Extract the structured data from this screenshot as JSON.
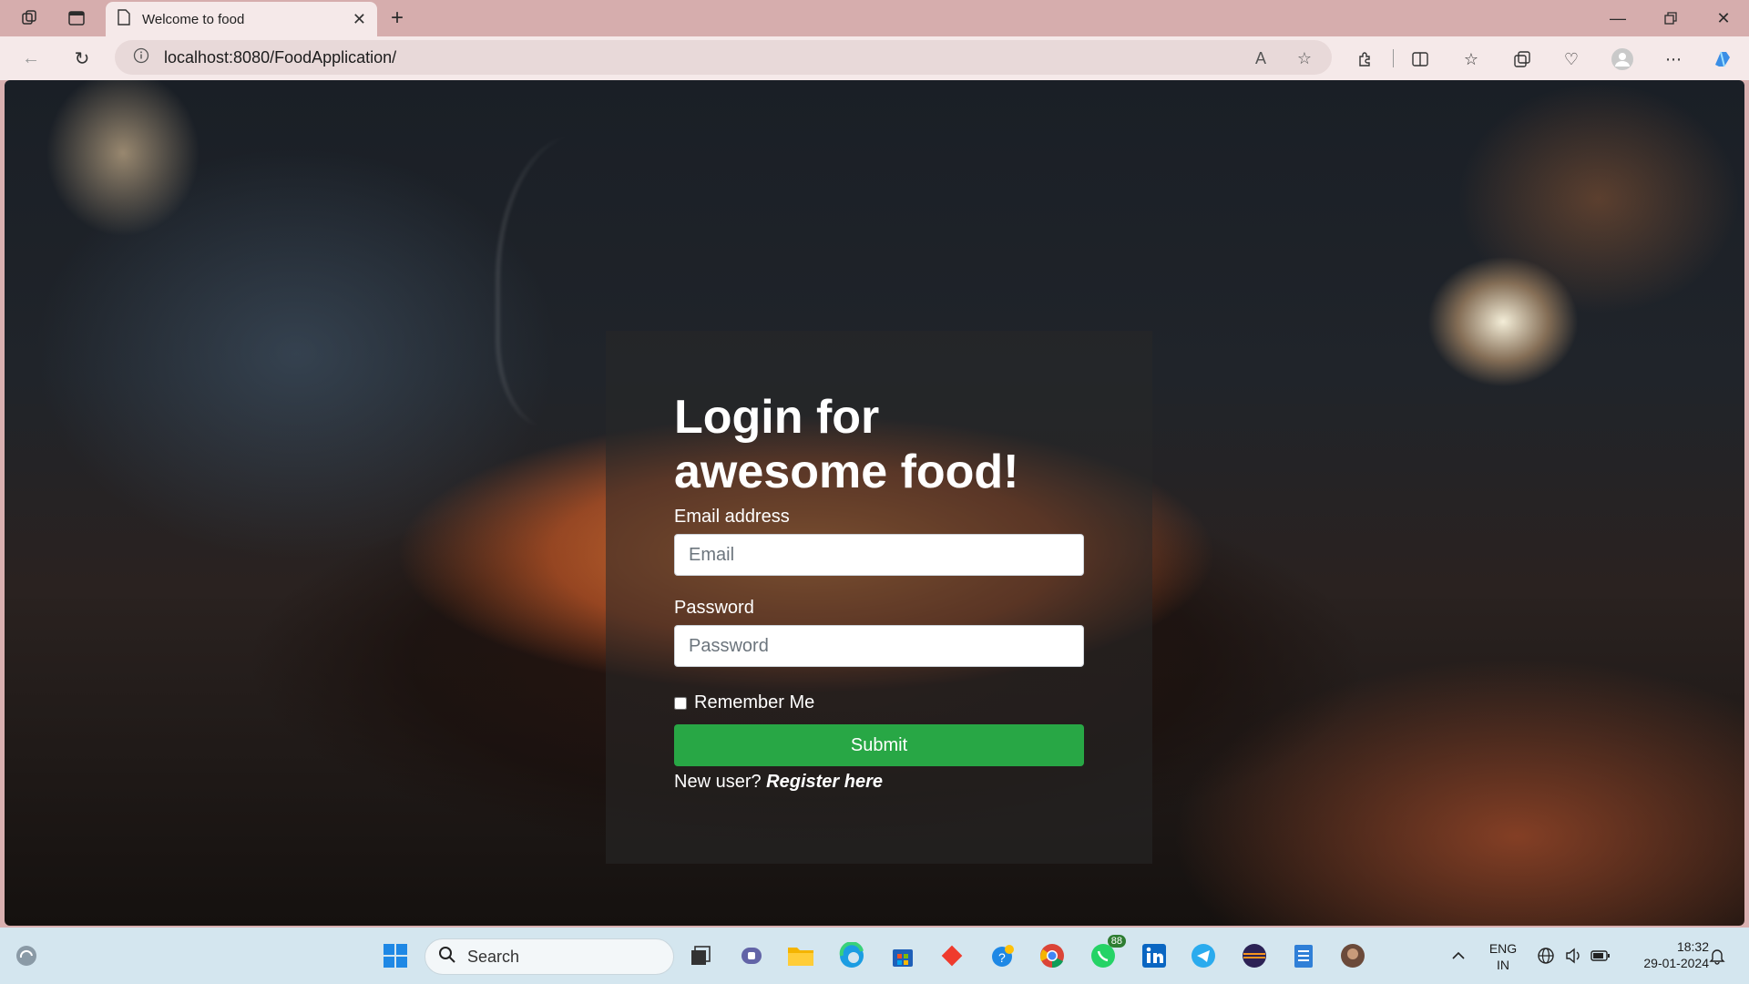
{
  "browser": {
    "tab_title": "Welcome to food",
    "url": "localhost:8080/FoodApplication/"
  },
  "login": {
    "title": "Login for awesome food!",
    "email_label": "Email address",
    "email_placeholder": "Email",
    "password_label": "Password",
    "password_placeholder": "Password",
    "remember_label": "Remember Me",
    "submit_label": "Submit",
    "new_user_text": "New user?",
    "register_link": "Register here"
  },
  "colors": {
    "submit_green": "#28a745",
    "taskbar_bg": "#d4e6ef",
    "tabbar_bg": "#d6adad"
  },
  "taskbar": {
    "search_label": "Search",
    "whatsapp_badge": "88",
    "lang_top": "ENG",
    "lang_bottom": "IN",
    "time": "18:32",
    "date": "29-01-2024"
  }
}
